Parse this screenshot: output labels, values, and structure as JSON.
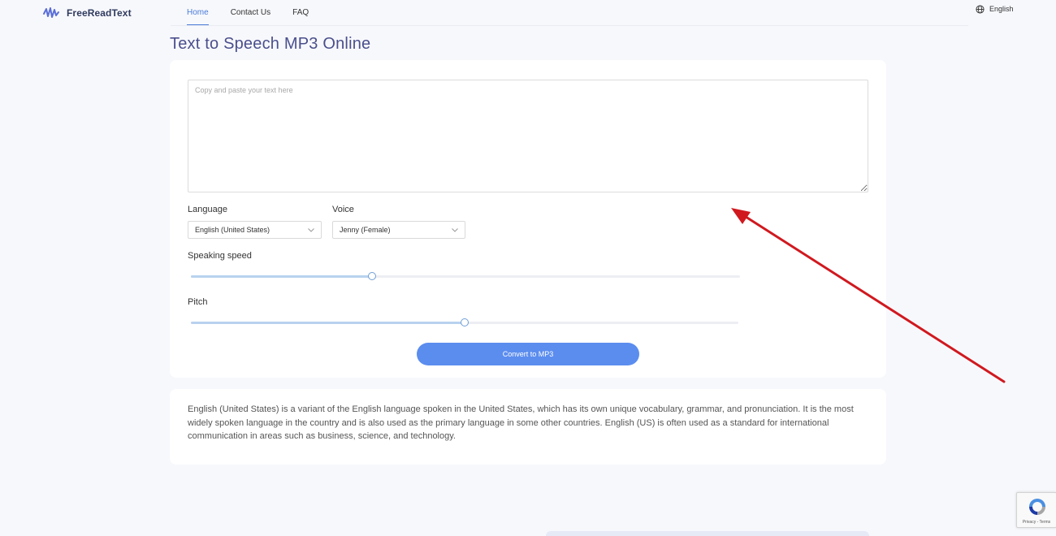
{
  "header": {
    "brand": "FreeReadText",
    "nav": [
      {
        "label": "Home",
        "active": true
      },
      {
        "label": "Contact Us",
        "active": false
      },
      {
        "label": "FAQ",
        "active": false
      }
    ],
    "language_label": "English",
    "icons": {
      "logo": "waveform-logo-icon",
      "language": "globe-icon"
    }
  },
  "page": {
    "title": "Text to Speech MP3 Online"
  },
  "form": {
    "text_placeholder": "Copy and paste your text here",
    "text_value": "",
    "language": {
      "label": "Language",
      "value": "English (United States)"
    },
    "voice": {
      "label": "Voice",
      "value": "Jenny (Female)"
    },
    "speed": {
      "label": "Speaking speed",
      "value": 0.33
    },
    "pitch": {
      "label": "Pitch",
      "value": 0.5
    },
    "convert_label": "Convert to MP3"
  },
  "info": {
    "text": "English (United States) is a variant of the English language spoken in the United States, which has its own unique vocabulary, grammar, and pronunciation. It is the most widely spoken language in the country and is also used as the primary language in some other countries. English (US) is often used as a standard for international communication in areas such as business, science, and technology."
  },
  "recaptcha": {
    "footer": "Privacy - Terms"
  },
  "colors": {
    "accent": "#5b8def",
    "title": "#4a4f8c",
    "annotation_arrow": "#d0191f",
    "slider_fill": "#b8d2ee"
  }
}
